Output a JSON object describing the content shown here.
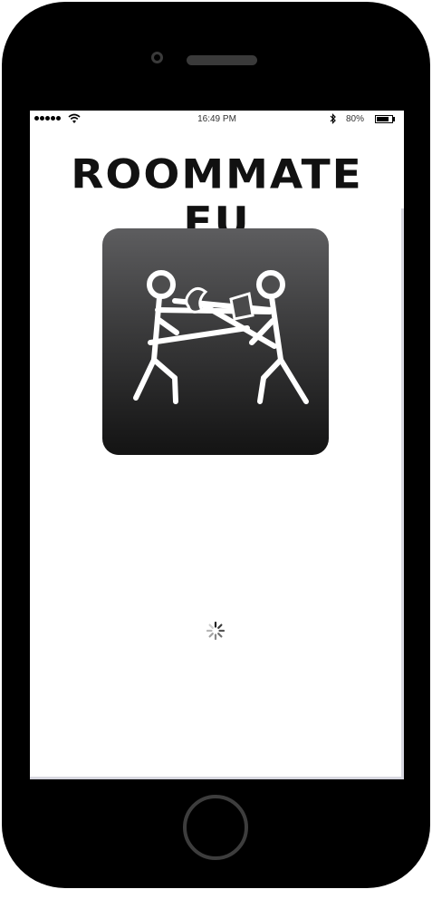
{
  "status_bar": {
    "time": "16:49 PM",
    "battery_percent": "80%",
    "battery_level": 0.8,
    "signal_icon": "signal-dots-icon",
    "wifi_icon": "wifi-icon",
    "bluetooth_icon": "bluetooth-icon"
  },
  "app": {
    "title": "ROOMMATE FU",
    "logo_icon": "fighting-stick-figures-logo-icon",
    "loading_icon": "activity-spinner-icon"
  },
  "colors": {
    "device_frame": "#000000",
    "screen_background": "#ffffff",
    "logo_gradient_top": "#5d5d5f",
    "logo_gradient_bottom": "#131313"
  }
}
